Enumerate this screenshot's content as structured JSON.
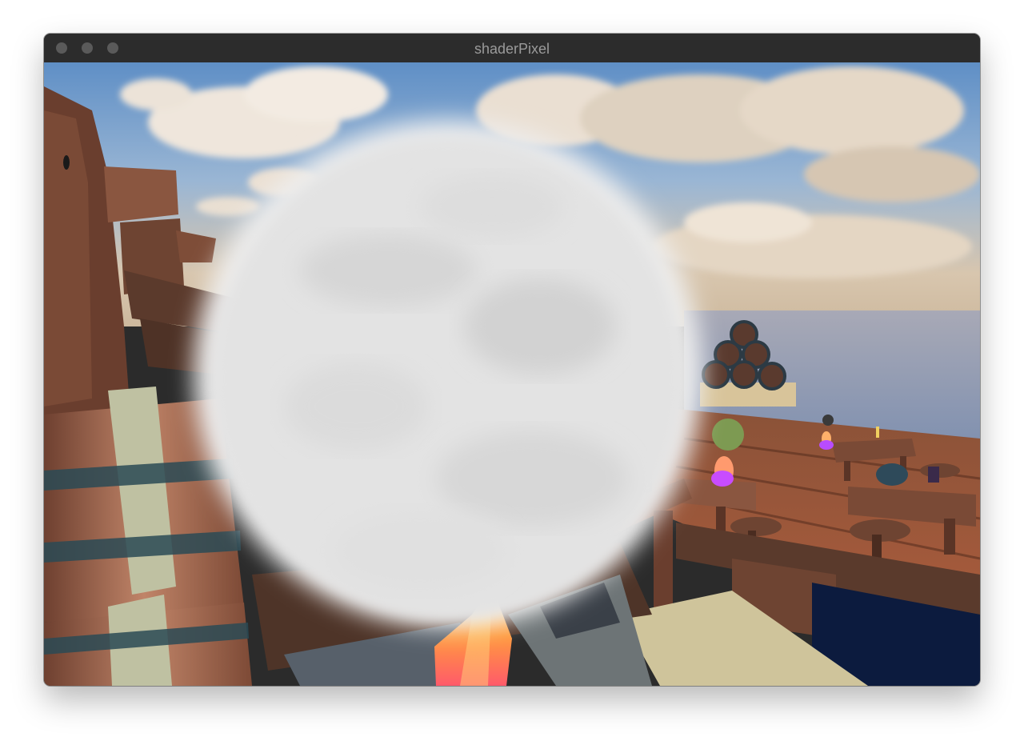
{
  "window": {
    "title": "shaderPixel"
  },
  "controls": {
    "close_icon": "close-icon",
    "minimize_icon": "minimize-icon",
    "zoom_icon": "zoom-icon"
  },
  "colors": {
    "sky_top": "#6f9ccd",
    "sky_horizon": "#d9c7b0",
    "ocean": "#8f9fb8",
    "wood": "#8a5a3e",
    "cloud_sphere": "#e4e4e4",
    "crystal": "#ff8a3a",
    "magic_flame": "#c84cff"
  }
}
